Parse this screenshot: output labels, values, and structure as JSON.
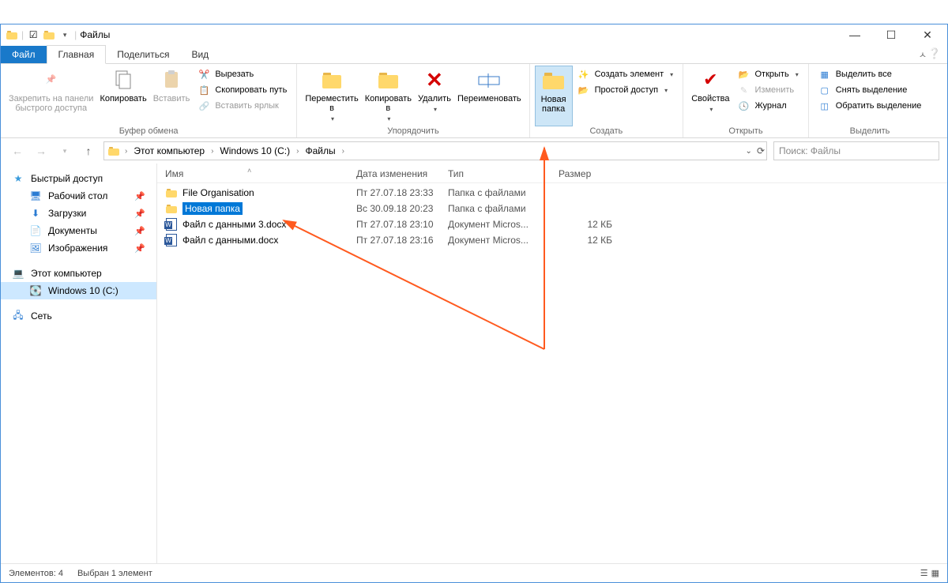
{
  "window": {
    "title": "Файлы"
  },
  "tabs": {
    "file": "Файл",
    "home": "Главная",
    "share": "Поделиться",
    "view": "Вид"
  },
  "ribbon": {
    "clipboard": {
      "pin": "Закрепить на панели\nбыстрого доступа",
      "copy": "Копировать",
      "paste": "Вставить",
      "cut": "Вырезать",
      "copy_path": "Скопировать путь",
      "paste_shortcut": "Вставить ярлык",
      "label": "Буфер обмена"
    },
    "organize": {
      "move_to": "Переместить\nв",
      "copy_to": "Копировать\nв",
      "delete": "Удалить",
      "rename": "Переименовать",
      "label": "Упорядочить"
    },
    "new": {
      "new_folder": "Новая\nпапка",
      "new_item": "Создать элемент",
      "easy_access": "Простой доступ",
      "label": "Создать"
    },
    "open": {
      "properties": "Свойства",
      "open": "Открыть",
      "edit": "Изменить",
      "history": "Журнал",
      "label": "Открыть"
    },
    "select": {
      "select_all": "Выделить все",
      "select_none": "Снять выделение",
      "invert": "Обратить выделение",
      "label": "Выделить"
    }
  },
  "breadcrumb": {
    "pc": "Этот компьютер",
    "drive": "Windows 10 (C:)",
    "folder": "Файлы"
  },
  "search": {
    "placeholder": "Поиск: Файлы"
  },
  "sidebar": {
    "quick": "Быстрый доступ",
    "desktop": "Рабочий стол",
    "downloads": "Загрузки",
    "documents": "Документы",
    "pictures": "Изображения",
    "this_pc": "Этот компьютер",
    "drive": "Windows 10 (C:)",
    "network": "Сеть"
  },
  "columns": {
    "name": "Имя",
    "date": "Дата изменения",
    "type": "Тип",
    "size": "Размер"
  },
  "files": [
    {
      "name": "File Organisation",
      "date": "Пт 27.07.18 23:33",
      "type": "Папка с файлами",
      "size": ""
    },
    {
      "name": "Новая папка",
      "date": "Вс 30.09.18 20:23",
      "type": "Папка с файлами",
      "size": "",
      "editing": true
    },
    {
      "name": "Файл с данными 3.docx",
      "date": "Пт 27.07.18 23:10",
      "type": "Документ Micros...",
      "size": "12 КБ"
    },
    {
      "name": "Файл с данными.docx",
      "date": "Пт 27.07.18 23:16",
      "type": "Документ Micros...",
      "size": "12 КБ"
    }
  ],
  "status": {
    "count": "Элементов: 4",
    "selected": "Выбран 1 элемент"
  }
}
